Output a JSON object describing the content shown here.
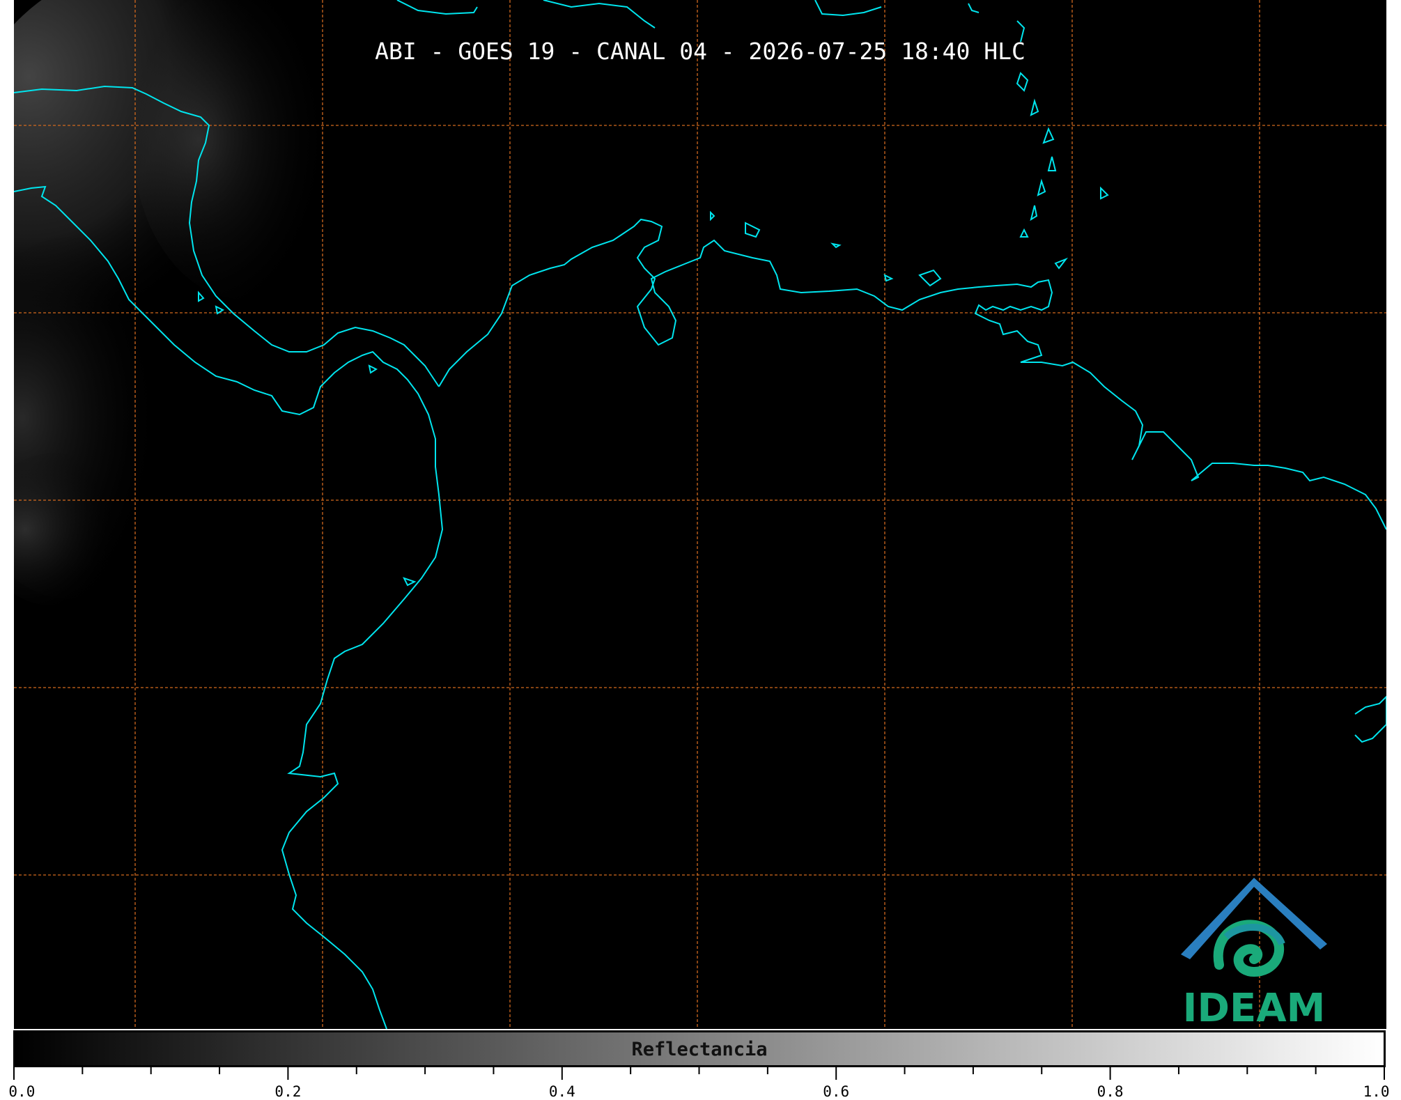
{
  "title": "ABI - GOES 19 - CANAL 04 - 2026-07-25 18:40 HLC",
  "colors": {
    "coastline": "#00e5ee",
    "grid": "#d2691e",
    "background": "#000000",
    "logo_teal": "#1aaa7a",
    "logo_blue": "#2a7fc0"
  },
  "colorbar": {
    "label": "Reflectancia",
    "min": 0.0,
    "max": 1.0,
    "tick_labels": [
      "0.0",
      "0.2",
      "0.4",
      "0.6",
      "0.8",
      "1.0"
    ],
    "major_ticks": [
      0.0,
      0.2,
      0.4,
      0.6,
      0.8,
      1.0
    ],
    "minor_step": 0.05
  },
  "logo": {
    "text": "IDEAM",
    "icon": "ideam-mountain-swirl-logo"
  },
  "grid_lines": "dashed",
  "coastline_icon": "coastline-outline"
}
